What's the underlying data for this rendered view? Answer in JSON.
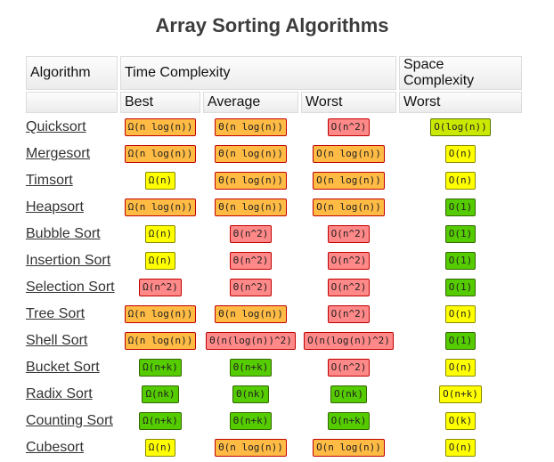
{
  "page": {
    "title": "Array Sorting Algorithms"
  },
  "table": {
    "header1": {
      "algorithm": "Algorithm",
      "time": "Time Complexity",
      "space": "Space Complexity"
    },
    "header2": {
      "algorithm": "",
      "best": "Best",
      "average": "Average",
      "worst": "Worst",
      "space_worst": "Worst"
    },
    "rows": [
      {
        "name": "Quicksort",
        "best": {
          "text": "Ω(n log(n))",
          "grade": "orange"
        },
        "average": {
          "text": "Θ(n log(n))",
          "grade": "orange"
        },
        "worst": {
          "text": "O(n^2)",
          "grade": "red"
        },
        "space": {
          "text": "O(log(n))",
          "grade": "lime"
        }
      },
      {
        "name": "Mergesort",
        "best": {
          "text": "Ω(n log(n))",
          "grade": "orange"
        },
        "average": {
          "text": "Θ(n log(n))",
          "grade": "orange"
        },
        "worst": {
          "text": "O(n log(n))",
          "grade": "orange"
        },
        "space": {
          "text": "O(n)",
          "grade": "yellow"
        }
      },
      {
        "name": "Timsort",
        "best": {
          "text": "Ω(n)",
          "grade": "yellow"
        },
        "average": {
          "text": "Θ(n log(n))",
          "grade": "orange"
        },
        "worst": {
          "text": "O(n log(n))",
          "grade": "orange"
        },
        "space": {
          "text": "O(n)",
          "grade": "yellow"
        }
      },
      {
        "name": "Heapsort",
        "best": {
          "text": "Ω(n log(n))",
          "grade": "orange"
        },
        "average": {
          "text": "Θ(n log(n))",
          "grade": "orange"
        },
        "worst": {
          "text": "O(n log(n))",
          "grade": "orange"
        },
        "space": {
          "text": "O(1)",
          "grade": "green"
        }
      },
      {
        "name": "Bubble Sort",
        "best": {
          "text": "Ω(n)",
          "grade": "yellow"
        },
        "average": {
          "text": "Θ(n^2)",
          "grade": "red"
        },
        "worst": {
          "text": "O(n^2)",
          "grade": "red"
        },
        "space": {
          "text": "O(1)",
          "grade": "green"
        }
      },
      {
        "name": "Insertion Sort",
        "best": {
          "text": "Ω(n)",
          "grade": "yellow"
        },
        "average": {
          "text": "Θ(n^2)",
          "grade": "red"
        },
        "worst": {
          "text": "O(n^2)",
          "grade": "red"
        },
        "space": {
          "text": "O(1)",
          "grade": "green"
        }
      },
      {
        "name": "Selection Sort",
        "best": {
          "text": "Ω(n^2)",
          "grade": "red"
        },
        "average": {
          "text": "Θ(n^2)",
          "grade": "red"
        },
        "worst": {
          "text": "O(n^2)",
          "grade": "red"
        },
        "space": {
          "text": "O(1)",
          "grade": "green"
        }
      },
      {
        "name": "Tree Sort",
        "best": {
          "text": "Ω(n log(n))",
          "grade": "orange"
        },
        "average": {
          "text": "Θ(n log(n))",
          "grade": "orange"
        },
        "worst": {
          "text": "O(n^2)",
          "grade": "red"
        },
        "space": {
          "text": "O(n)",
          "grade": "yellow"
        }
      },
      {
        "name": "Shell Sort",
        "best": {
          "text": "Ω(n log(n))",
          "grade": "orange"
        },
        "average": {
          "text": "Θ(n(log(n))^2)",
          "grade": "red"
        },
        "worst": {
          "text": "O(n(log(n))^2)",
          "grade": "red"
        },
        "space": {
          "text": "O(1)",
          "grade": "green"
        }
      },
      {
        "name": "Bucket Sort",
        "best": {
          "text": "Ω(n+k)",
          "grade": "green"
        },
        "average": {
          "text": "Θ(n+k)",
          "grade": "green"
        },
        "worst": {
          "text": "O(n^2)",
          "grade": "red"
        },
        "space": {
          "text": "O(n)",
          "grade": "yellow"
        }
      },
      {
        "name": "Radix Sort",
        "best": {
          "text": "Ω(nk)",
          "grade": "green"
        },
        "average": {
          "text": "Θ(nk)",
          "grade": "green"
        },
        "worst": {
          "text": "O(nk)",
          "grade": "green"
        },
        "space": {
          "text": "O(n+k)",
          "grade": "yellow"
        }
      },
      {
        "name": "Counting Sort",
        "best": {
          "text": "Ω(n+k)",
          "grade": "green"
        },
        "average": {
          "text": "Θ(n+k)",
          "grade": "green"
        },
        "worst": {
          "text": "O(n+k)",
          "grade": "green"
        },
        "space": {
          "text": "O(k)",
          "grade": "yellow"
        }
      },
      {
        "name": "Cubesort",
        "best": {
          "text": "Ω(n)",
          "grade": "yellow"
        },
        "average": {
          "text": "Θ(n log(n))",
          "grade": "orange"
        },
        "worst": {
          "text": "O(n log(n))",
          "grade": "orange"
        },
        "space": {
          "text": "O(n)",
          "grade": "yellow"
        }
      }
    ]
  },
  "colors": {
    "red": "#ff8888",
    "orange": "#ffbb44",
    "yellow": "#ffff00",
    "lime": "#cbe900",
    "green": "#55cc00"
  }
}
